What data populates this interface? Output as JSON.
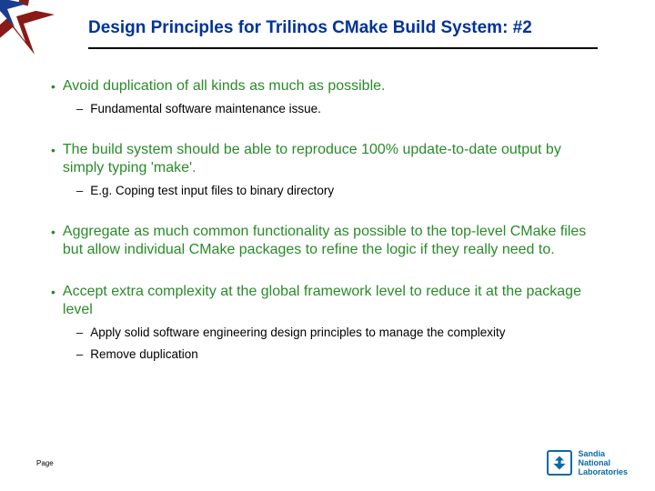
{
  "title": "Design Principles for Trilinos CMake Build System: #2",
  "groups": [
    {
      "main": "Avoid duplication of all kinds as much as possible.",
      "subs": [
        "Fundamental software maintenance issue."
      ]
    },
    {
      "main": "The build system should be able to reproduce 100% update-to-date output by simply typing 'make'.",
      "subs": [
        "E.g. Coping test input files to binary directory"
      ]
    },
    {
      "main": "Aggregate as much common functionality as possible to the top-level CMake files but allow individual CMake packages to refine the logic if they really need to.",
      "subs": []
    },
    {
      "main": "Accept extra complexity at the global framework level to reduce it at the package level",
      "subs": [
        "Apply solid software engineering design principles to manage the complexity",
        "Remove duplication"
      ]
    }
  ],
  "footer": {
    "page_label": "Page"
  },
  "logo": {
    "line1": "Sandia",
    "line2": "National",
    "line3": "Laboratories"
  }
}
